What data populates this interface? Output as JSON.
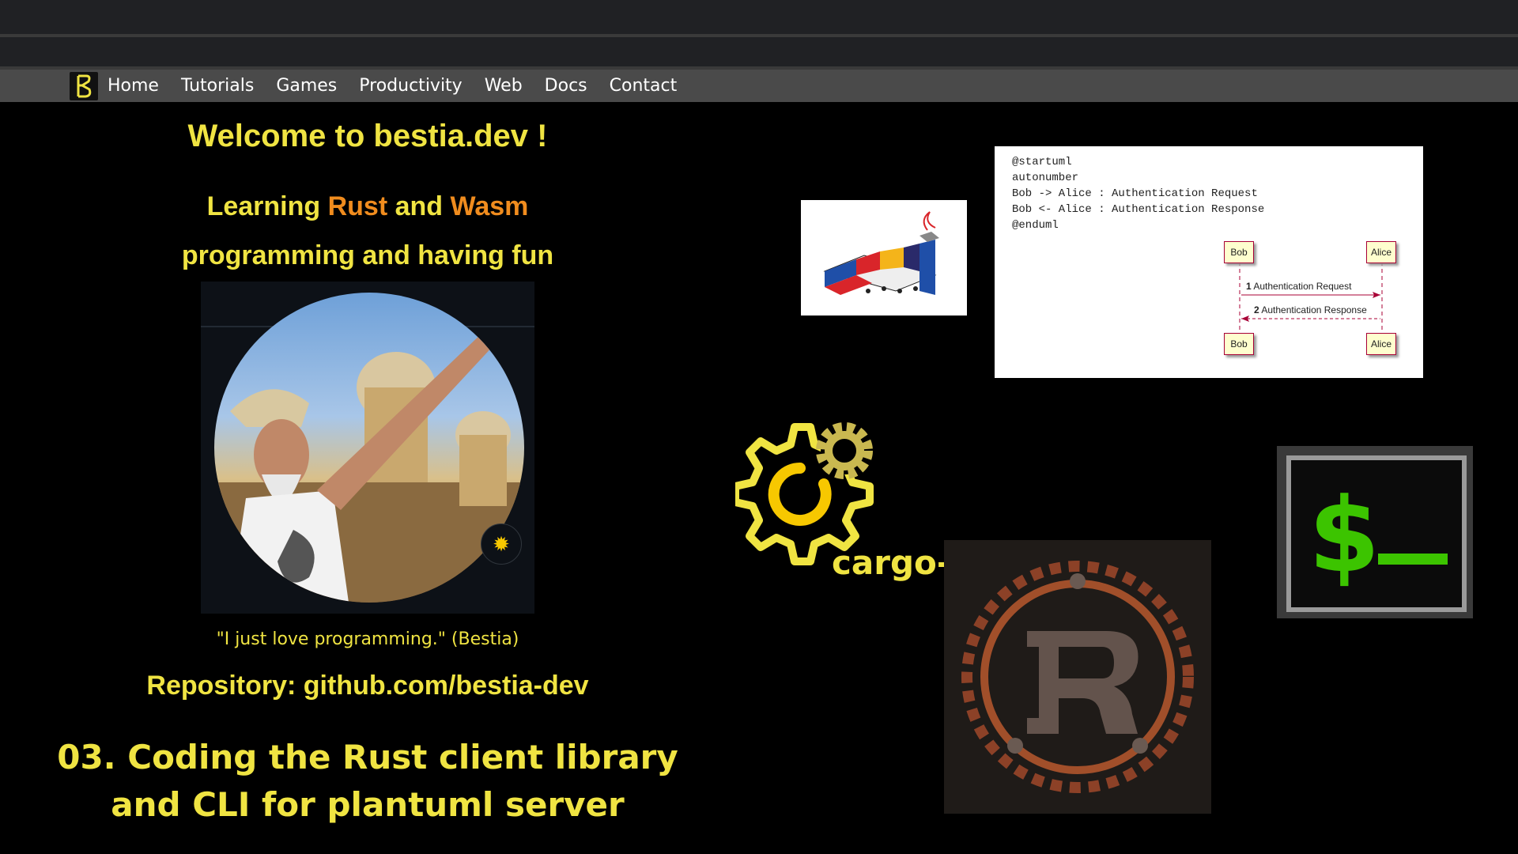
{
  "nav": {
    "items": [
      "Home",
      "Tutorials",
      "Games",
      "Productivity",
      "Web",
      "Docs",
      "Contact"
    ]
  },
  "hero": {
    "welcome": "Welcome to bestia.dev !",
    "learning_pre": "Learning ",
    "rust": "Rust",
    "and": " and ",
    "wasm": "Wasm",
    "line2": "programming and having fun",
    "quote": "\"I just love programming.\" (Bestia)",
    "repo": "Repository: github.com/bestia-dev",
    "episode_line1": "03. Coding the Rust client library",
    "episode_line2": "and CLI for plantuml server"
  },
  "plantuml": {
    "code": "@startuml\nautonumber\nBob -> Alice : Authentication Request\nBob <- Alice : Authentication Response\n@enduml",
    "bob": "Bob",
    "alice": "Alice",
    "msg1_num": "1",
    "msg1": "Authentication Request",
    "msg2_num": "2",
    "msg2": "Authentication Response"
  },
  "cargo_auto": {
    "label": "cargo-auto"
  },
  "colors": {
    "accent_yellow": "#f0e442",
    "accent_orange": "#f08c1e",
    "navbar": "#4a4a4a",
    "terminal_green": "#3cc400"
  },
  "icons": [
    "bestia-logo-icon",
    "uml-logo-icon",
    "cargo-auto-gear-icon",
    "rust-logo-icon",
    "terminal-icon",
    "sun-icon"
  ]
}
